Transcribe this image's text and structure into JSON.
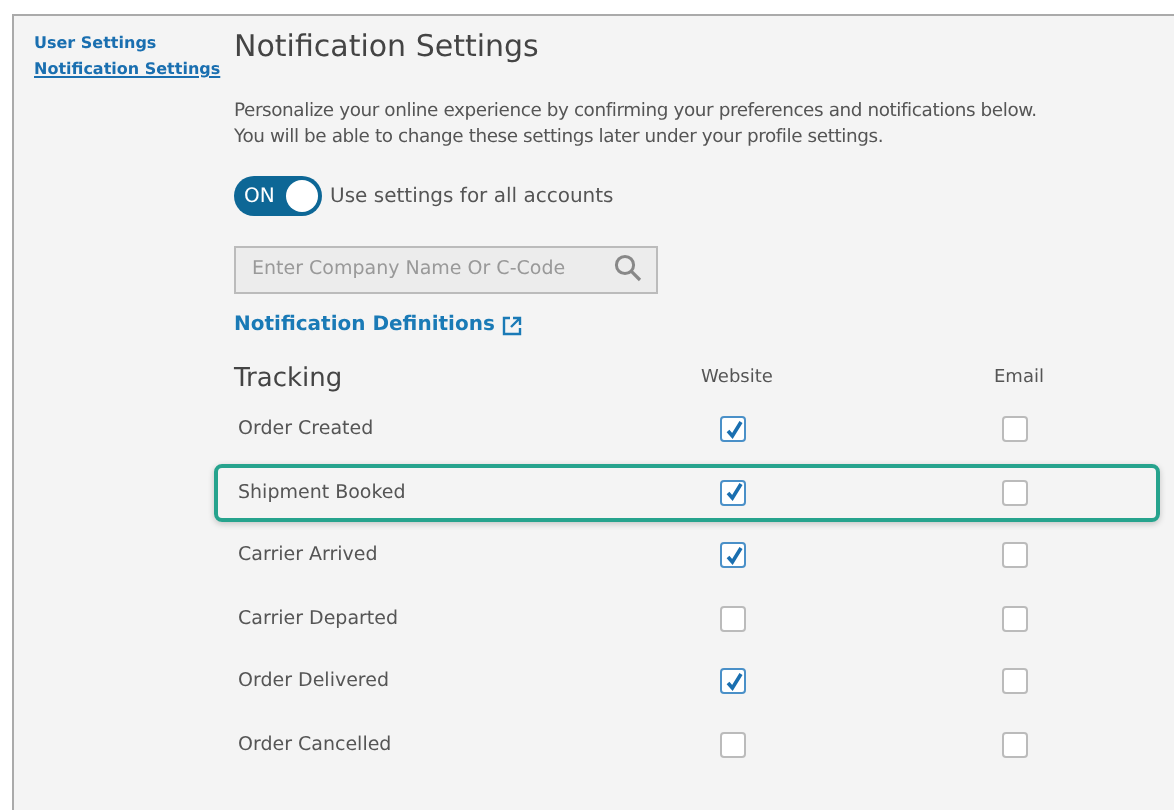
{
  "sidebar": {
    "items": [
      {
        "label": "User Settings",
        "selected": false
      },
      {
        "label": "Notification Settings",
        "selected": true
      }
    ]
  },
  "title": "Notification Settings",
  "description": [
    "Personalize your online experience by confirming your preferences and notifications below.",
    "You will be able to change these settings later under your profile settings."
  ],
  "toggle": {
    "label": "ON",
    "on": true,
    "text": "Use settings for all accounts"
  },
  "search": {
    "placeholder": "Enter Company Name Or C-Code"
  },
  "definitions_link": "Notification Definitions",
  "table": {
    "title": "Tracking",
    "columns": [
      "Website",
      "Email"
    ],
    "rows": [
      {
        "label": "Order Created",
        "website": true,
        "email": false,
        "highlighted": false
      },
      {
        "label": "Shipment Booked",
        "website": true,
        "email": false,
        "highlighted": true
      },
      {
        "label": "Carrier Arrived",
        "website": true,
        "email": false,
        "highlighted": false
      },
      {
        "label": "Carrier Departed",
        "website": false,
        "email": false,
        "highlighted": false
      },
      {
        "label": "Order Delivered",
        "website": true,
        "email": false,
        "highlighted": false
      },
      {
        "label": "Order Cancelled",
        "website": false,
        "email": false,
        "highlighted": false
      }
    ]
  }
}
